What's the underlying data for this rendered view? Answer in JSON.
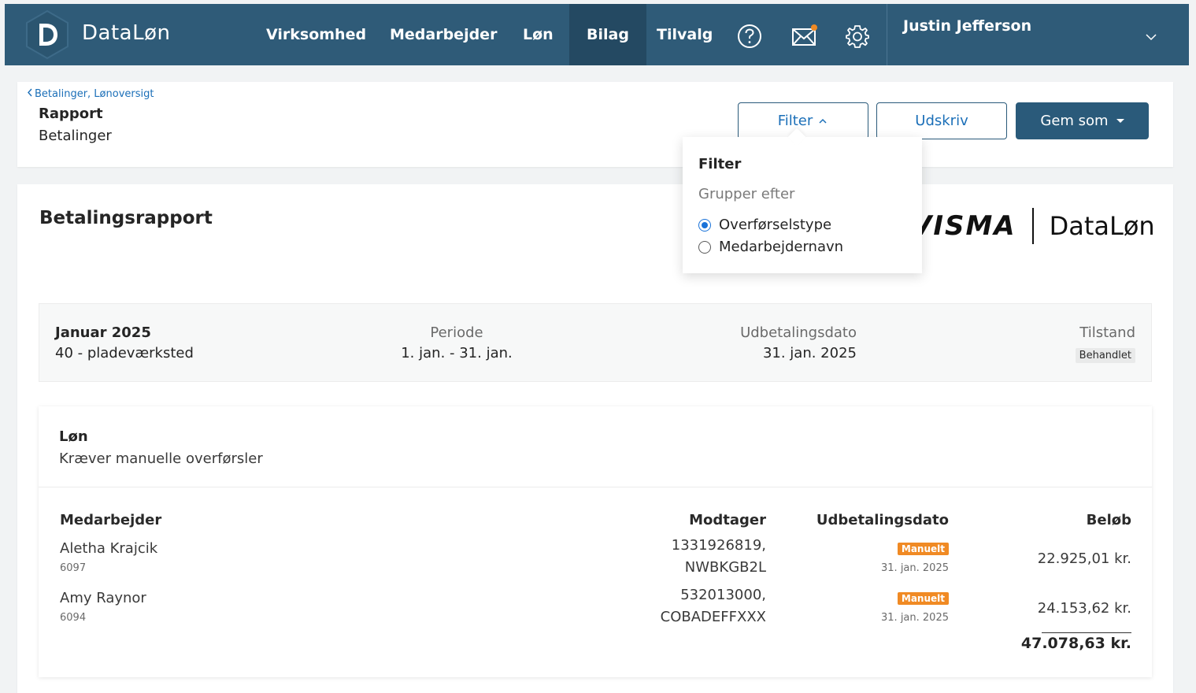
{
  "app": {
    "brand": "DataLøn",
    "nav": [
      "Virksomhed",
      "Medarbejder",
      "Løn",
      "Bilag",
      "Tilvalg"
    ],
    "active_nav": "Bilag",
    "user_name": "Justin Jefferson",
    "colors": {
      "topbar": "#2f5b78",
      "active": "#244962",
      "accent_blue": "#1b6fb8",
      "badge_orange": "#f08a24"
    }
  },
  "header": {
    "breadcrumb": "Betalinger, Lønoversigt",
    "title": "Rapport",
    "subtitle": "Betalinger",
    "filter_label": "Filter",
    "print_label": "Udskriv",
    "save_label": "Gem som"
  },
  "filter_popover": {
    "title": "Filter",
    "group_label": "Grupper efter",
    "options": [
      "Overførselstype",
      "Medarbejdernavn"
    ],
    "selected": "Overførselstype"
  },
  "report": {
    "title": "Betalingsrapport",
    "logo_visma": "VISMA",
    "logo_dataloen": "DataLøn",
    "period_name": "Januar 2025",
    "department": "40 - pladeværksted",
    "period_label": "Periode",
    "period_value": "1. jan. - 31. jan.",
    "payout_label": "Udbetalingsdato",
    "payout_value": "31. jan. 2025",
    "state_label": "Tilstand",
    "state_value": "Behandlet"
  },
  "section": {
    "title": "Løn",
    "subtitle": "Kræver manuelle overførsler",
    "columns": [
      "Medarbejder",
      "Modtager",
      "Udbetalingsdato",
      "Beløb"
    ],
    "rows": [
      {
        "name": "Aletha Krajcik",
        "id": "6097",
        "recipient_1": "1331926819,",
        "recipient_2": "NWBKGB2L",
        "badge": "Manuelt",
        "date": "31. jan. 2025",
        "amount": "22.925,01 kr."
      },
      {
        "name": "Amy Raynor",
        "id": "6094",
        "recipient_1": "532013000,",
        "recipient_2": "COBADEFFXXX",
        "badge": "Manuelt",
        "date": "31. jan. 2025",
        "amount": "24.153,62 kr."
      }
    ],
    "total": "47.078,63 kr."
  }
}
